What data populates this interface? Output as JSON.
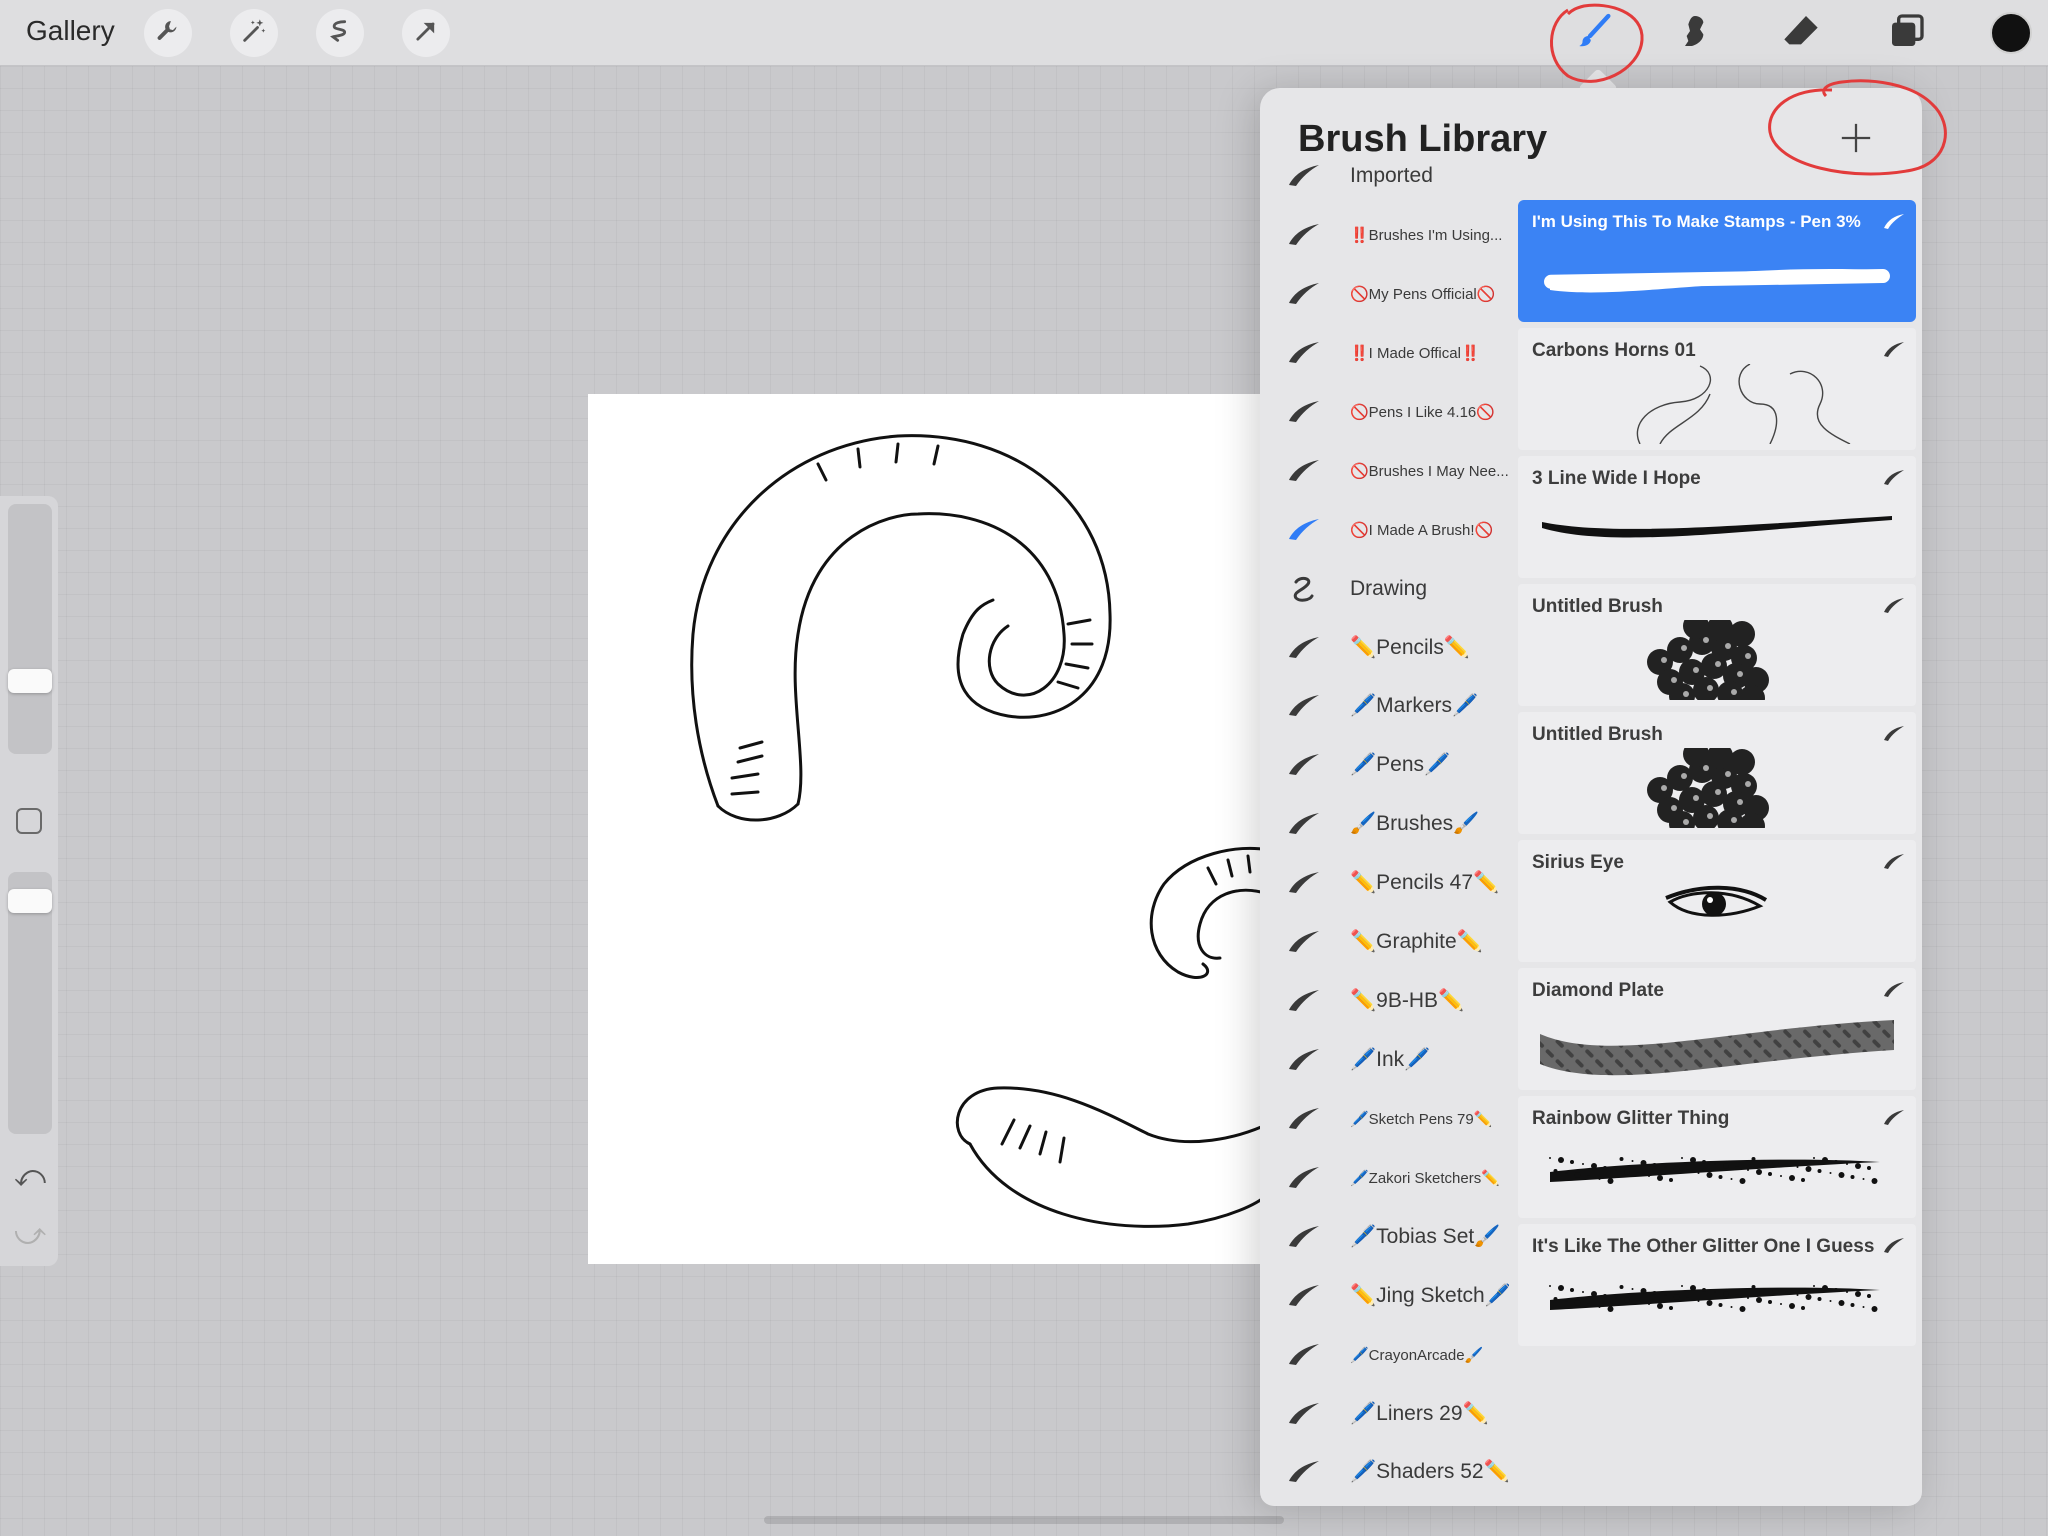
{
  "topbar": {
    "gallery_label": "Gallery",
    "left_tools": [
      "wrench-icon",
      "magic-wand-icon",
      "selection-icon",
      "transform-arrow-icon"
    ],
    "right_tools": [
      "brush-icon",
      "smudge-icon",
      "eraser-icon",
      "layers-icon"
    ],
    "active_tool": "brush",
    "accent_color": "#2f7cf6",
    "current_color": "#111111"
  },
  "sidebar": {
    "brush_size_fraction": 0.27,
    "opacity_fraction": 0.07
  },
  "panel": {
    "title": "Brush Library",
    "add_button": "+",
    "brush_sets": [
      {
        "label": "Imported",
        "size": "big"
      },
      {
        "label": "‼️Brushes I'm Using...",
        "size": "small"
      },
      {
        "label": "🚫My Pens Official🚫",
        "size": "small"
      },
      {
        "label": "‼️I Made Offical‼️",
        "size": "small"
      },
      {
        "label": "🚫Pens I Like 4.16🚫",
        "size": "small"
      },
      {
        "label": "🚫Brushes I May Nee...",
        "size": "small"
      },
      {
        "label": "🚫I Made A Brush!🚫",
        "size": "small",
        "active": true
      },
      {
        "label": "Drawing",
        "size": "big"
      },
      {
        "label": "✏️Pencils✏️",
        "size": "big"
      },
      {
        "label": "🖊️Markers🖊️",
        "size": "big"
      },
      {
        "label": "🖊️Pens🖊️",
        "size": "big"
      },
      {
        "label": "🖌️Brushes🖌️",
        "size": "big"
      },
      {
        "label": "✏️Pencils 47✏️",
        "size": "big"
      },
      {
        "label": "✏️Graphite✏️",
        "size": "big"
      },
      {
        "label": "✏️9B-HB✏️",
        "size": "big"
      },
      {
        "label": "🖊️Ink🖊️",
        "size": "big"
      },
      {
        "label": "🖊️Sketch Pens 79✏️",
        "size": "small"
      },
      {
        "label": "🖊️Zakori Sketchers✏️",
        "size": "small"
      },
      {
        "label": "🖊️Tobias Set🖌️",
        "size": "big"
      },
      {
        "label": "✏️Jing Sketch🖊️",
        "size": "big"
      },
      {
        "label": "🖊️CrayonArcade🖌️",
        "size": "small"
      },
      {
        "label": "🖊️Liners 29✏️",
        "size": "big"
      },
      {
        "label": "🖊️Shaders 52✏️",
        "size": "big"
      }
    ],
    "brushes": [
      {
        "name": "I'm Using This To Make Stamps - Pen 3%",
        "preview": "pen-stroke",
        "active": true
      },
      {
        "name": "Carbons Horns 01",
        "preview": "horns-stamp"
      },
      {
        "name": "3 Line Wide I Hope",
        "preview": "thick-stroke"
      },
      {
        "name": "Untitled Brush",
        "preview": "tree-stamp"
      },
      {
        "name": "Untitled Brush",
        "preview": "tree-stamp"
      },
      {
        "name": "Sirius Eye",
        "preview": "eye-stamp"
      },
      {
        "name": "Diamond Plate",
        "preview": "diamond-plate-stroke"
      },
      {
        "name": "Rainbow Glitter Thing",
        "preview": "glitter-stroke"
      },
      {
        "name": "It's Like The Other Glitter One I Guess",
        "preview": "glitter-stroke"
      }
    ]
  }
}
